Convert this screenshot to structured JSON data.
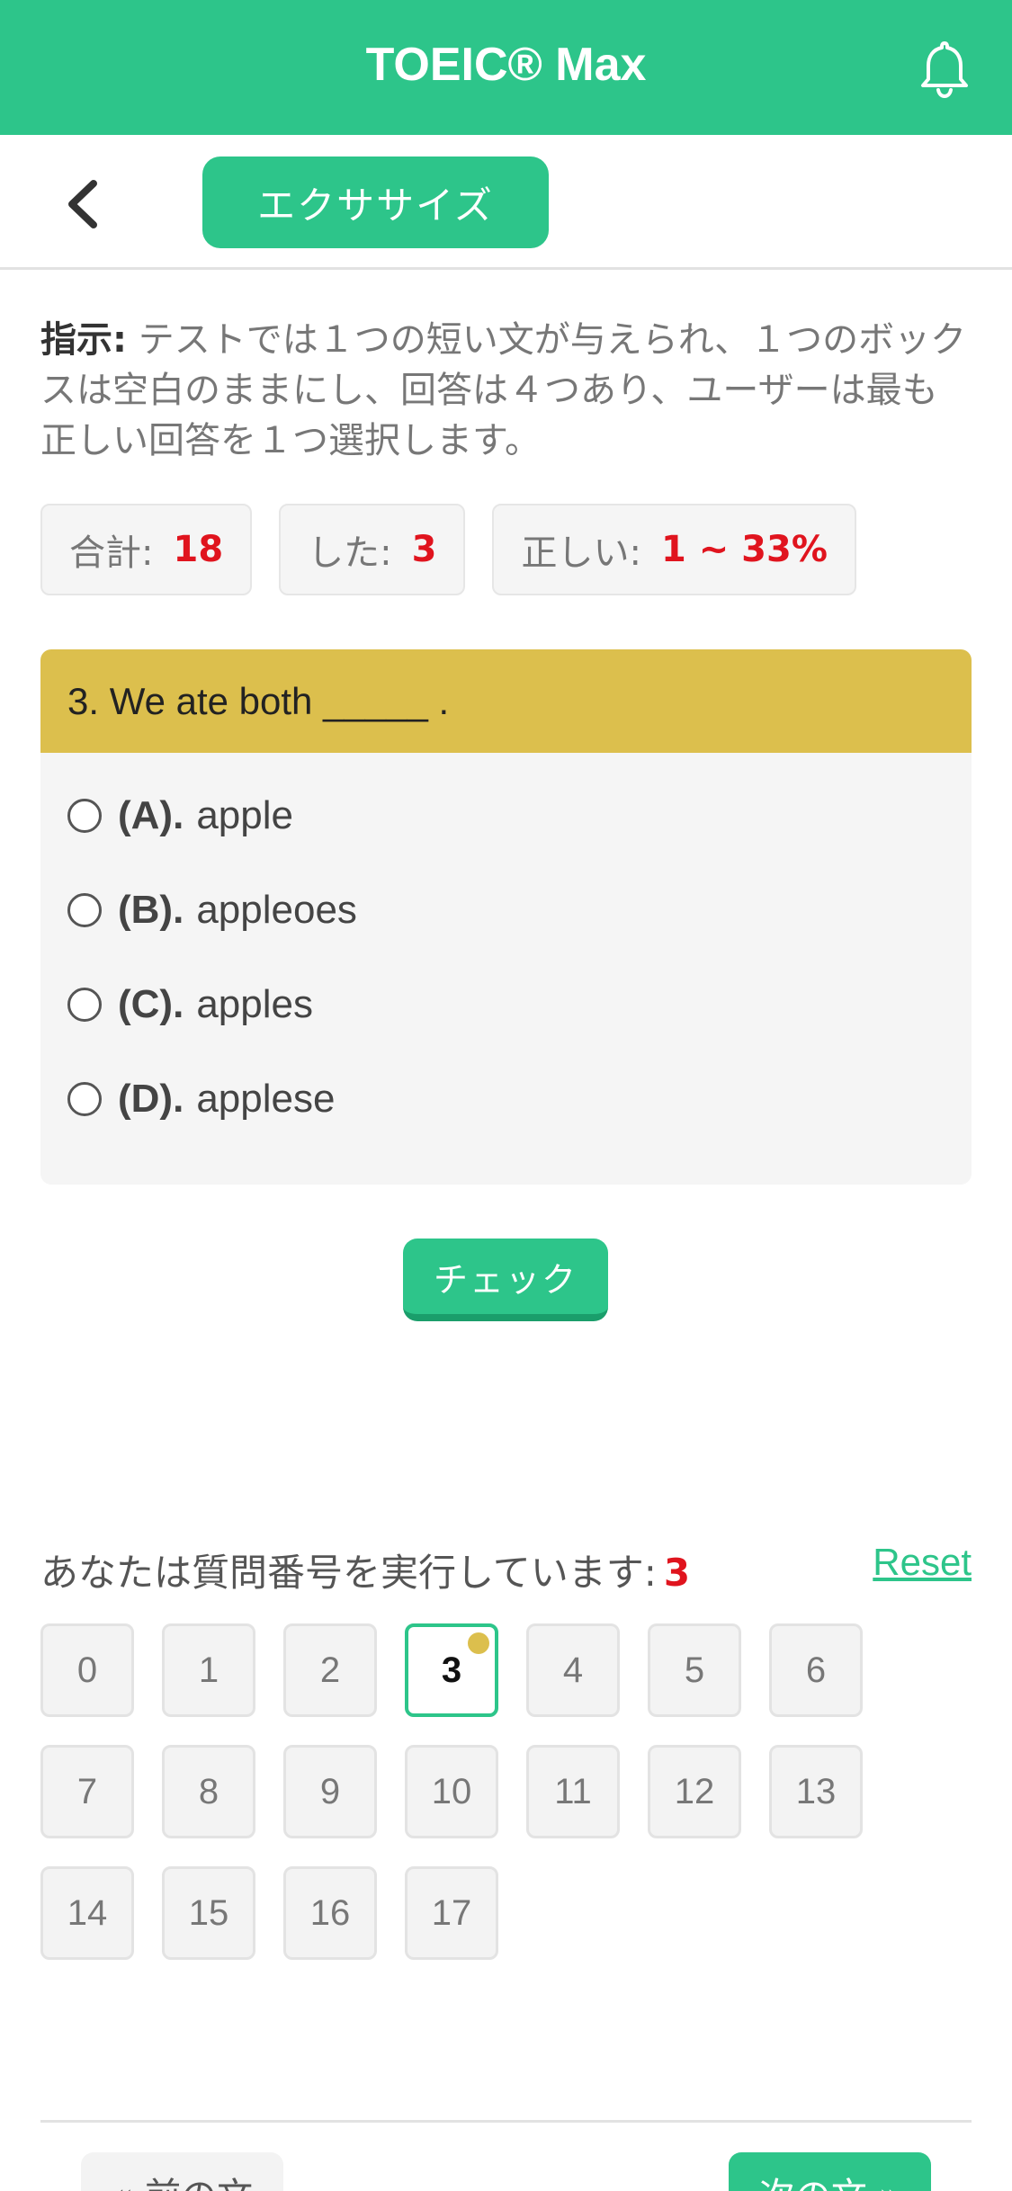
{
  "header": {
    "title": "TOEIC® Max",
    "notification_icon": "bell-icon"
  },
  "nav": {
    "back_icon": "chevron-left-icon",
    "tab_label": "エクササイズ"
  },
  "instruction": {
    "label": "指示:",
    "text": " テストでは１つの短い文が与えられ、１つのボックスは空白のままにし、回答は４つあり、ユーザーは最も正しい回答を１つ選択します。"
  },
  "stats": {
    "total_label": "合計:",
    "total_value": "18",
    "done_label": "した:",
    "done_value": "3",
    "correct_label": "正しい:",
    "correct_value": "1 ~ 33%"
  },
  "question": {
    "text": "3. We ate both _____ .",
    "options": [
      {
        "letter": "(A).",
        "text": "apple"
      },
      {
        "letter": "(B).",
        "text": "appleoes"
      },
      {
        "letter": "(C).",
        "text": "apples"
      },
      {
        "letter": "(D).",
        "text": "applese"
      }
    ]
  },
  "check_button": "チェック",
  "progress": {
    "label": "あなたは質問番号を実行しています:",
    "current": "3",
    "reset_label": "Reset",
    "numbers": [
      "0",
      "1",
      "2",
      "3",
      "4",
      "5",
      "6",
      "7",
      "8",
      "9",
      "10",
      "11",
      "12",
      "13",
      "14",
      "15",
      "16",
      "17"
    ]
  },
  "footer": {
    "prev_label": "« 前の文",
    "next_label": "次の文 »"
  },
  "colors": {
    "brand": "#2dc58a",
    "question_header": "#dcbf4d",
    "highlight": "#e0141e"
  }
}
